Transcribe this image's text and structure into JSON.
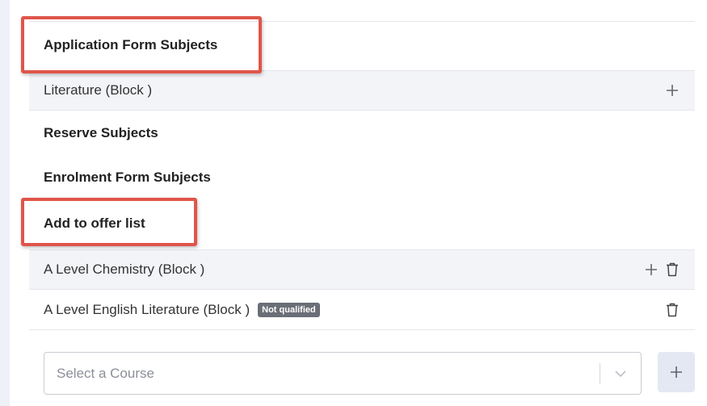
{
  "sections": {
    "application_form_subjects": "Application Form Subjects",
    "reserve_subjects": "Reserve Subjects",
    "enrolment_form_subjects": "Enrolment Form Subjects",
    "add_to_offer_list": "Add to offer list"
  },
  "application_subjects": [
    {
      "label": "Literature (Block )"
    }
  ],
  "offer_list": [
    {
      "label": "A Level Chemistry (Block )"
    },
    {
      "label": "A Level English Literature (Block )",
      "badge": "Not qualified"
    }
  ],
  "course_select": {
    "placeholder": "Select a Course"
  },
  "icons": {
    "add": "plus-icon",
    "delete": "trash-icon",
    "dropdown": "chevron-down-icon"
  },
  "colors": {
    "highlight": "#e0554a",
    "badge_bg": "#6a6e76",
    "shaded_row": "#f3f4f8",
    "add_button_bg": "#e4e8f3"
  }
}
